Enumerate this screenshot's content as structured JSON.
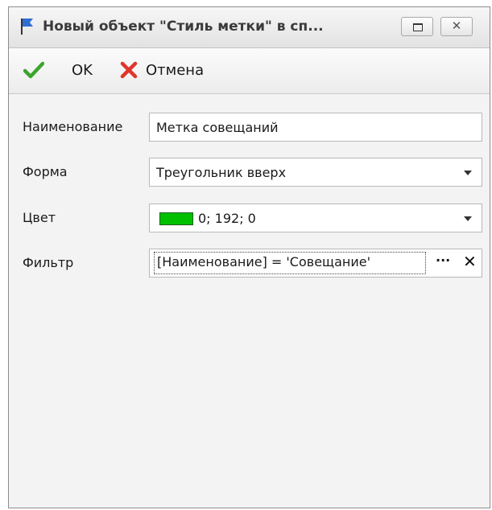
{
  "window": {
    "title": "Новый объект \"Стиль метки\" в сп...",
    "icons": {
      "title": "flag-icon",
      "maximize": "maximize-icon",
      "close": "close-icon"
    }
  },
  "toolbar": {
    "ok_label": "OK",
    "ok_icon": "checkmark-icon",
    "cancel_label": "Отмена",
    "cancel_icon": "cross-icon"
  },
  "form": {
    "name": {
      "label": "Наименование",
      "value": "Метка совещаний"
    },
    "shape": {
      "label": "Форма",
      "value": "Треугольник вверх"
    },
    "color": {
      "label": "Цвет",
      "value": "0; 192; 0",
      "swatch": "#00c000"
    },
    "filter": {
      "label": "Фильтр",
      "value": "[Наименование] = 'Совещание'",
      "ellipsis": "···",
      "clear": "✕"
    }
  },
  "colors": {
    "ok_check": "#3aa52c",
    "cancel_cross": "#e0352b",
    "flag": "#2f6fd0"
  }
}
